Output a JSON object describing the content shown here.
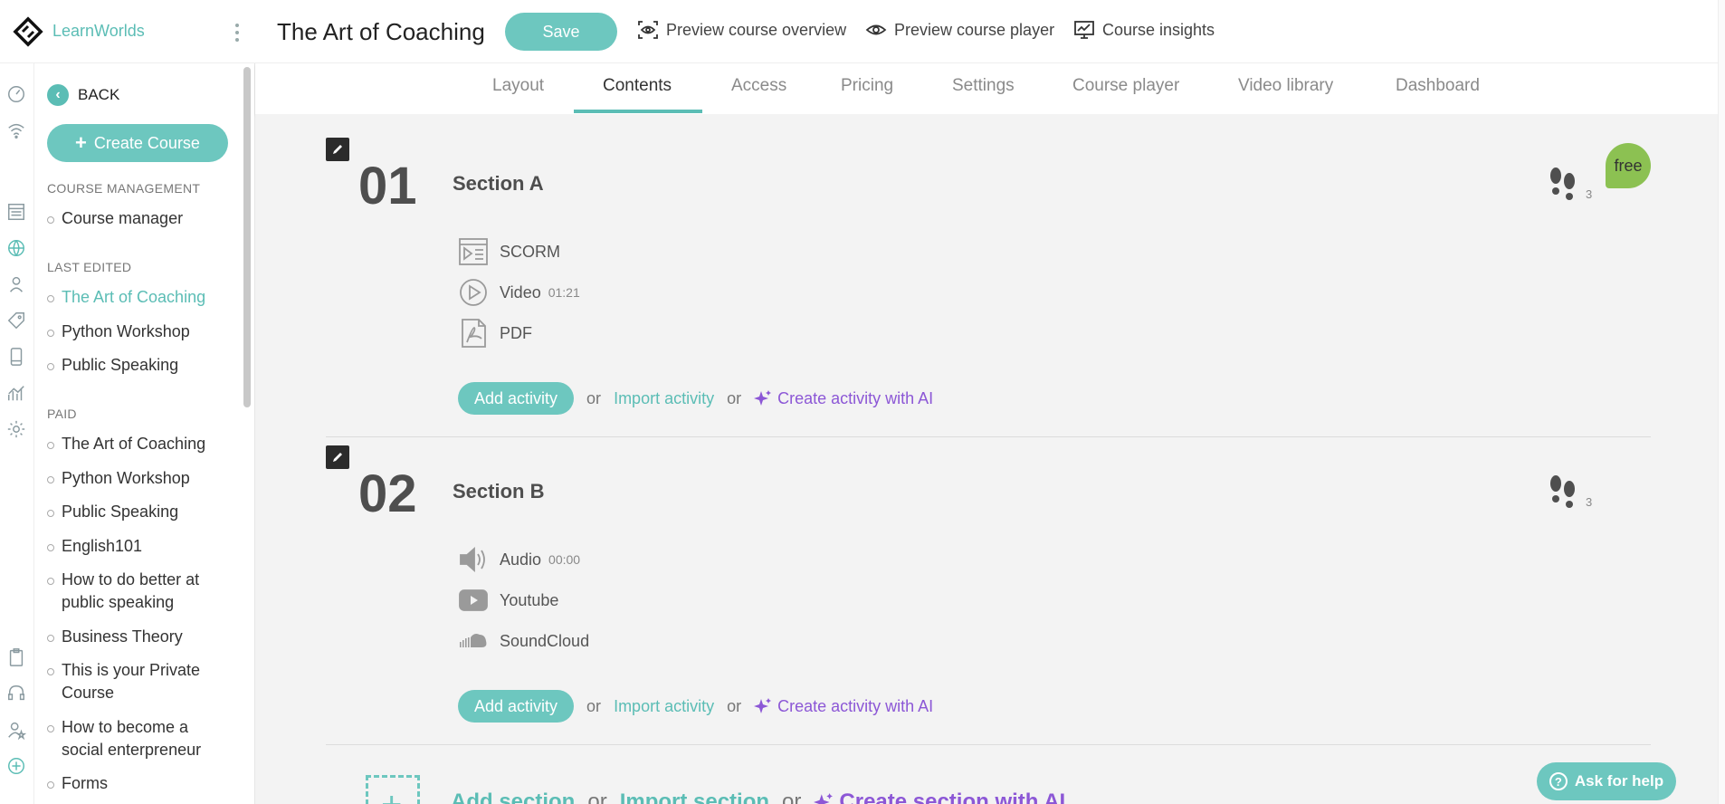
{
  "brand": {
    "name": "LearnWorlds"
  },
  "sidebar": {
    "back_label": "BACK",
    "create_course_label": "Create Course",
    "course_management": {
      "heading": "COURSE MANAGEMENT",
      "items": [
        "Course manager"
      ]
    },
    "last_edited": {
      "heading": "LAST EDITED",
      "items": [
        "The Art of Coaching",
        "Python Workshop",
        "Public Speaking"
      ]
    },
    "paid": {
      "heading": "PAID",
      "items": [
        "The Art of Coaching",
        "Python Workshop",
        "Public Speaking",
        "English101",
        "How to do better at public speaking",
        "Business Theory",
        "This is your Private Course",
        "How to become a social enterpreneur",
        "Forms"
      ]
    }
  },
  "header": {
    "title": "The Art of Coaching",
    "save_label": "Save",
    "preview_overview": "Preview course overview",
    "preview_player": "Preview course player",
    "insights": "Course insights"
  },
  "tabs": [
    "Layout",
    "Contents",
    "Access",
    "Pricing",
    "Settings",
    "Course player",
    "Video library",
    "Dashboard"
  ],
  "active_tab": "Contents",
  "sections": [
    {
      "number": "01",
      "title": "Section A",
      "step_count": "3",
      "badge": "free",
      "activities": [
        {
          "type": "scorm-icon",
          "label": "SCORM",
          "duration": ""
        },
        {
          "type": "video-icon",
          "label": "Video",
          "duration": "01:21"
        },
        {
          "type": "pdf-icon",
          "label": "PDF",
          "duration": ""
        }
      ]
    },
    {
      "number": "02",
      "title": "Section B",
      "step_count": "3",
      "badge": "",
      "activities": [
        {
          "type": "audio-icon",
          "label": "Audio",
          "duration": "00:00"
        },
        {
          "type": "youtube-icon",
          "label": "Youtube",
          "duration": ""
        },
        {
          "type": "soundcloud-icon",
          "label": "SoundCloud",
          "duration": ""
        }
      ]
    }
  ],
  "actions": {
    "add_activity": "Add activity",
    "or": "or",
    "import_activity": "Import activity",
    "create_ai": "Create activity with AI"
  },
  "add_section": {
    "add": "Add section",
    "or": "or",
    "import": "Import section",
    "create_ai": "Create section with AI"
  },
  "help": {
    "label": "Ask for help"
  },
  "colors": {
    "accent": "#6dc7bf",
    "ai": "#8c57d6",
    "free": "#8cc152"
  }
}
